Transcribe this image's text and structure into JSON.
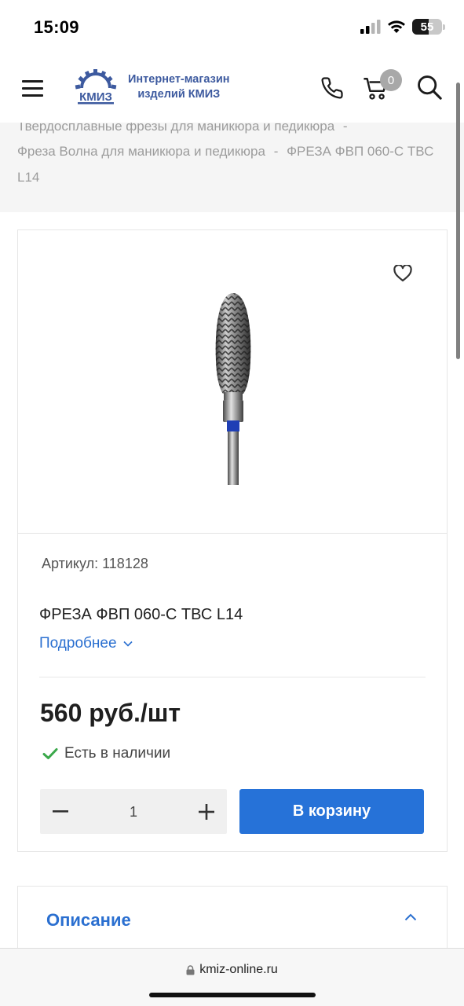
{
  "status_bar": {
    "time": "15:09",
    "battery_level": "55",
    "battery_percent": 55,
    "icons": [
      "cellular-signal-icon",
      "wifi-icon",
      "battery-icon"
    ]
  },
  "header": {
    "logo_line1": "Интернет-магазин",
    "logo_line2": "изделий КМИЗ",
    "logo_mark": "КМИЗ",
    "cart_count": "0",
    "icons": [
      "menu-icon",
      "phone-icon",
      "cart-icon",
      "search-icon"
    ]
  },
  "breadcrumb": {
    "items": [
      "Твердосплавные фрезы для маникюра и педикюра",
      "Фреза Волна для маникюра и педикюра",
      "ФРЕЗА ФВП 060-С ТВС L14"
    ],
    "last_line_wrap": "L14",
    "separator": "-"
  },
  "product": {
    "sku_label": "Артикул:",
    "sku_value": "118128",
    "name": "ФРЕЗА ФВП 060-С ТВС L14",
    "details_label": "Подробнее",
    "price": "560 руб./шт",
    "stock_text": "Есть в наличии",
    "quantity": "1",
    "add_to_cart_label": "В корзину"
  },
  "description": {
    "title": "Описание"
  },
  "browser": {
    "url": "kmiz-online.ru"
  },
  "colors": {
    "accent": "#2672d8",
    "logo": "#3d5a9f",
    "stock_check": "#3aa84a",
    "breadcrumb_bg": "#f5f5f5"
  }
}
